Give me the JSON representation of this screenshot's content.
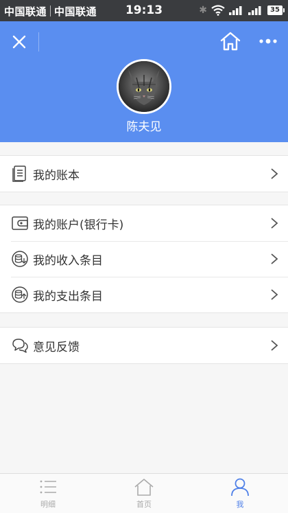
{
  "status_bar": {
    "carrier_1": "中国联通",
    "carrier_2": "中国联通",
    "time": "19:13",
    "battery": "35"
  },
  "profile": {
    "username": "陈夫见"
  },
  "menu_groups": [
    [
      {
        "label": "我的账本",
        "icon": "ledger-icon"
      }
    ],
    [
      {
        "label": "我的账户(银行卡)",
        "icon": "wallet-icon"
      },
      {
        "label": "我的收入条目",
        "icon": "income-icon"
      },
      {
        "label": "我的支出条目",
        "icon": "expense-icon"
      }
    ],
    [
      {
        "label": "意见反馈",
        "icon": "feedback-icon"
      }
    ]
  ],
  "tabbar": {
    "tabs": [
      {
        "label": "明细"
      },
      {
        "label": "首页"
      },
      {
        "label": "我"
      }
    ],
    "active_index": 2
  },
  "colors": {
    "header": "#5a8ef0",
    "active_tab": "#4f80e8"
  }
}
